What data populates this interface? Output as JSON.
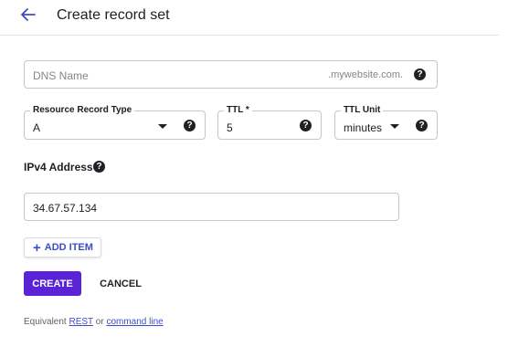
{
  "header": {
    "title": "Create record set",
    "back_icon": "arrow-back-icon",
    "accent_color": "#3c4dc6"
  },
  "dns_name": {
    "placeholder": "DNS Name",
    "suffix": ".mywebsite.com.",
    "help_icon": "help-icon"
  },
  "record_type": {
    "label": "Resource Record Type",
    "value": "A"
  },
  "ttl": {
    "label": "TTL *",
    "value": "5"
  },
  "ttl_unit": {
    "label": "TTL Unit",
    "value": "minutes"
  },
  "ipv4": {
    "label": "IPv4 Address",
    "value": "34.67.57.134"
  },
  "actions": {
    "add_item": "ADD ITEM",
    "create": "CREATE",
    "cancel": "CANCEL",
    "create_color": "#5a24d6"
  },
  "footer": {
    "prefix": "Equivalent",
    "rest_link": "REST",
    "or": "or",
    "command_line_link": "command line"
  }
}
